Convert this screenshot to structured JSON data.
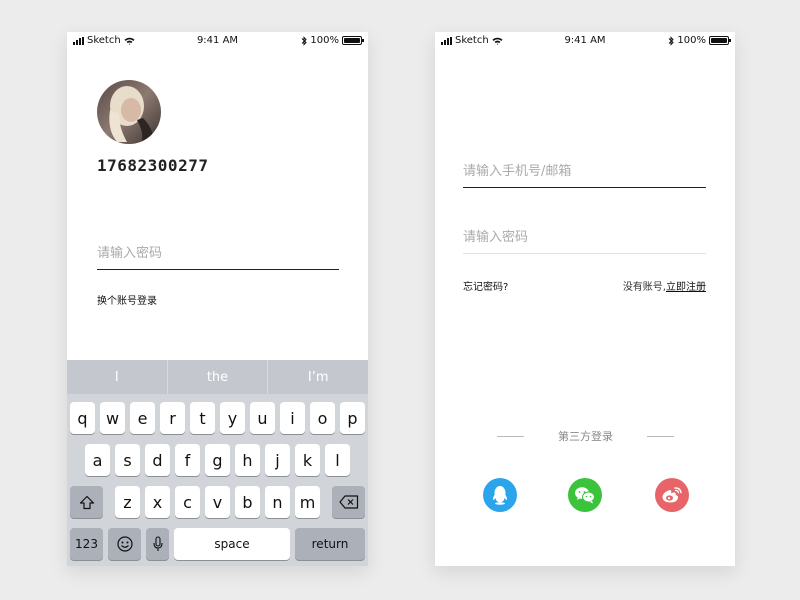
{
  "status_bar": {
    "carrier": "Sketch",
    "time": "9:41 AM",
    "battery": "100%"
  },
  "screen_one": {
    "phone_number": "17682300277",
    "password_placeholder": "请输入密码",
    "switch_account": "换个账号登录"
  },
  "keyboard": {
    "suggestions": [
      "I",
      "the",
      "I’m"
    ],
    "row1": [
      "q",
      "w",
      "e",
      "r",
      "t",
      "y",
      "u",
      "i",
      "o",
      "p"
    ],
    "row2": [
      "a",
      "s",
      "d",
      "f",
      "g",
      "h",
      "j",
      "k",
      "l"
    ],
    "row3": [
      "z",
      "x",
      "c",
      "v",
      "b",
      "n",
      "m"
    ],
    "numbers": "123",
    "space": "space",
    "return": "return"
  },
  "screen_two": {
    "phone_placeholder": "请输入手机号/邮箱",
    "password_placeholder": "请输入密码",
    "forgot_password": "忘记密码?",
    "no_account": "没有账号,",
    "register": "立即注册",
    "third_party": "第三方登录",
    "social_icons": [
      "qq-icon",
      "wechat-icon",
      "weibo-icon"
    ]
  },
  "colors": {
    "qq": "#2aa5ec",
    "wechat": "#3bc33b",
    "weibo": "#e76468",
    "keyboard": "#d1d4d9"
  }
}
